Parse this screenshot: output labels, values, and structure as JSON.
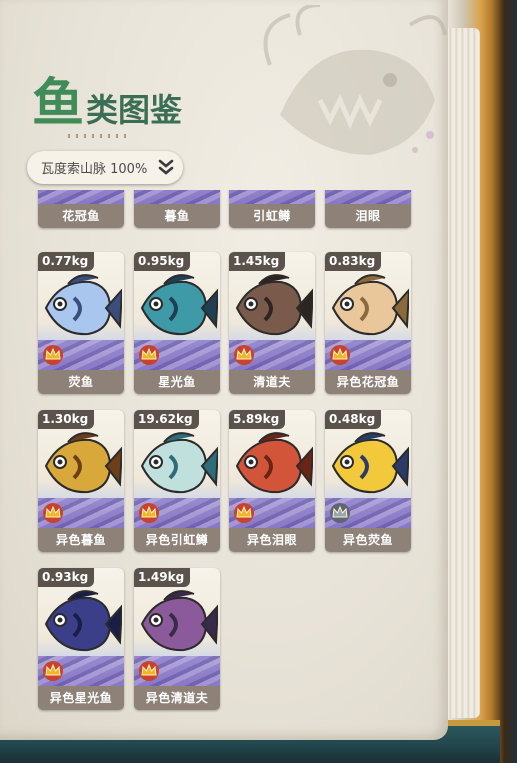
{
  "title": {
    "first_char": "鱼",
    "rest": "类图鉴"
  },
  "region_selector": {
    "label": "瓦度索山脉 100%",
    "icon": "double-chevron-down-icon"
  },
  "top_row": [
    {
      "name": "花冠鱼"
    },
    {
      "name": "暮鱼"
    },
    {
      "name": "引虹鳟"
    },
    {
      "name": "泪眼"
    }
  ],
  "fish": [
    {
      "weight": "0.77kg",
      "name": "荧鱼",
      "body": "#a9c6ee",
      "accent": "#3b4d7a",
      "crown": "gold"
    },
    {
      "weight": "0.95kg",
      "name": "星光鱼",
      "body": "#3f9aa8",
      "accent": "#1f3f55",
      "crown": "gold"
    },
    {
      "weight": "1.45kg",
      "name": "清道夫",
      "body": "#7a5a4a",
      "accent": "#2e2420",
      "crown": "gold"
    },
    {
      "weight": "0.83kg",
      "name": "异色花冠鱼",
      "body": "#e9c79a",
      "accent": "#8a6a3a",
      "crown": "gold"
    },
    {
      "weight": "1.30kg",
      "name": "异色暮鱼",
      "body": "#d9a83a",
      "accent": "#6a3f1a",
      "crown": "gold"
    },
    {
      "weight": "19.62kg",
      "name": "异色引虹鳟",
      "body": "#bfe0dc",
      "accent": "#2e6c7a",
      "crown": "gold"
    },
    {
      "weight": "5.89kg",
      "name": "异色泪眼",
      "body": "#d2553a",
      "accent": "#6a2416",
      "crown": "gold"
    },
    {
      "weight": "0.48kg",
      "name": "异色荧鱼",
      "body": "#f2c93a",
      "accent": "#2a3b6a",
      "crown": "silver"
    },
    {
      "weight": "0.93kg",
      "name": "异色星光鱼",
      "body": "#3b3f8a",
      "accent": "#1a1d45",
      "crown": "gold"
    },
    {
      "weight": "1.49kg",
      "name": "异色清道夫",
      "body": "#8a5a9a",
      "accent": "#3a2a4a",
      "crown": "gold"
    }
  ],
  "colors": {
    "title_green": "#3f8c5a",
    "card_footer": "#8d8178",
    "weight_tag": "#5b524c"
  }
}
